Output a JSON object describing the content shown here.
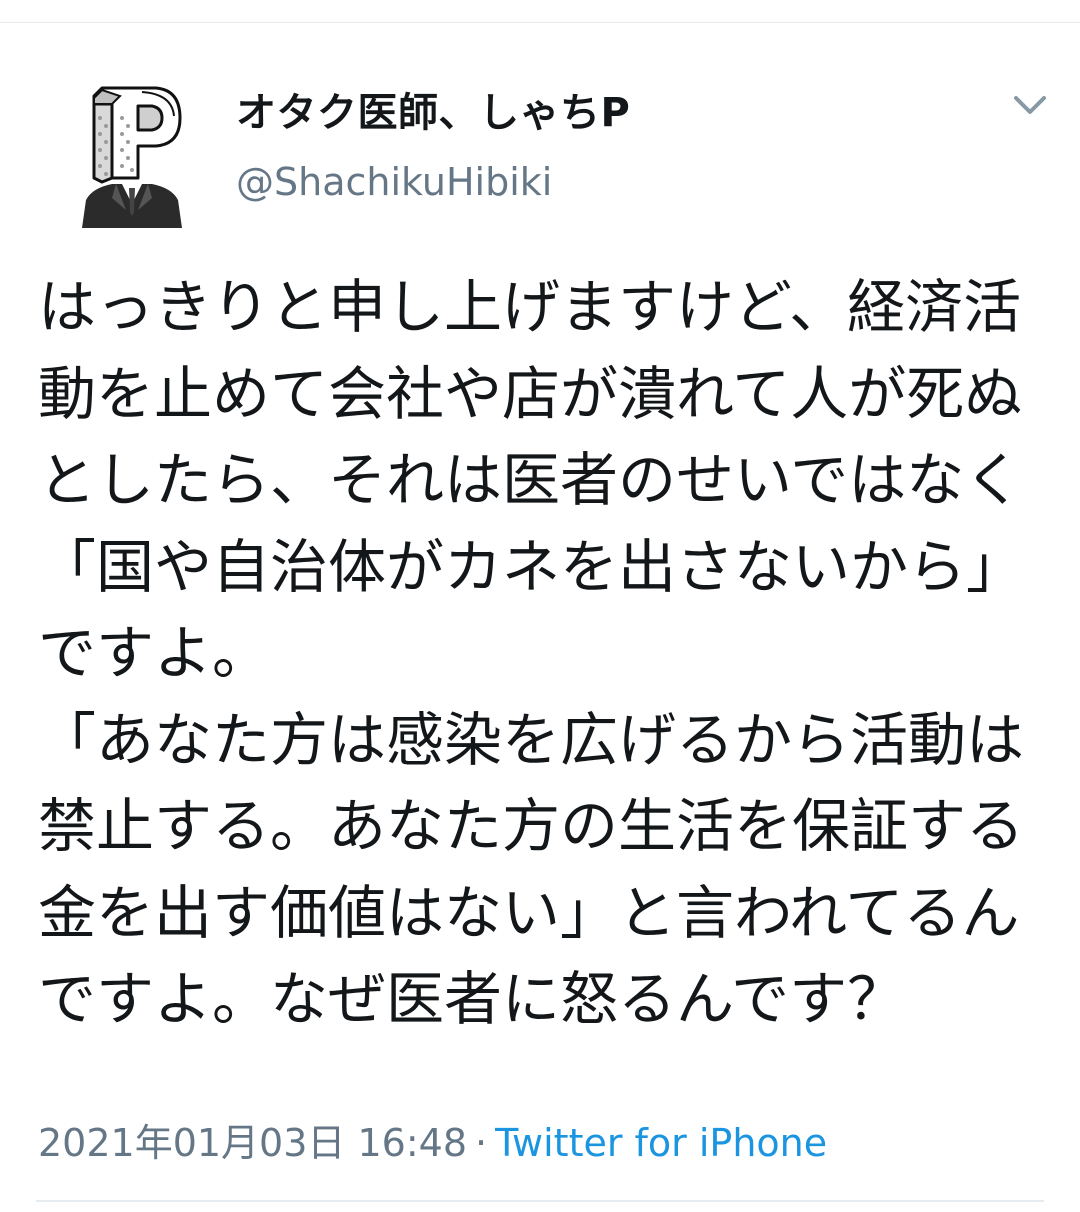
{
  "tweet": {
    "author": {
      "display_name": "オタク医師、しゃちP",
      "handle": "@ShachikuHibiki",
      "avatar_icon": "p-letter-suit-avatar-icon"
    },
    "text": "はっきりと申し上げますけど、経済活動を止めて会社や店が潰れて人が死ぬとしたら、それは医者のせいではなく「国や自治体がカネを出さないから」ですよ。\n「あなた方は感染を広げるから活動は禁止する。あなた方の生活を保証する金を出す価値はない」と言われてるんですよ。なぜ医者に怒るんです？",
    "timestamp": "2021年01月03日 16:48",
    "separator": "·",
    "source": "Twitter for iPhone"
  },
  "icons": {
    "menu": "chevron-down-icon"
  },
  "colors": {
    "text_primary": "#14171a",
    "text_secondary": "#657786",
    "link": "#1b95e0",
    "divider": "#e6ecf0"
  }
}
